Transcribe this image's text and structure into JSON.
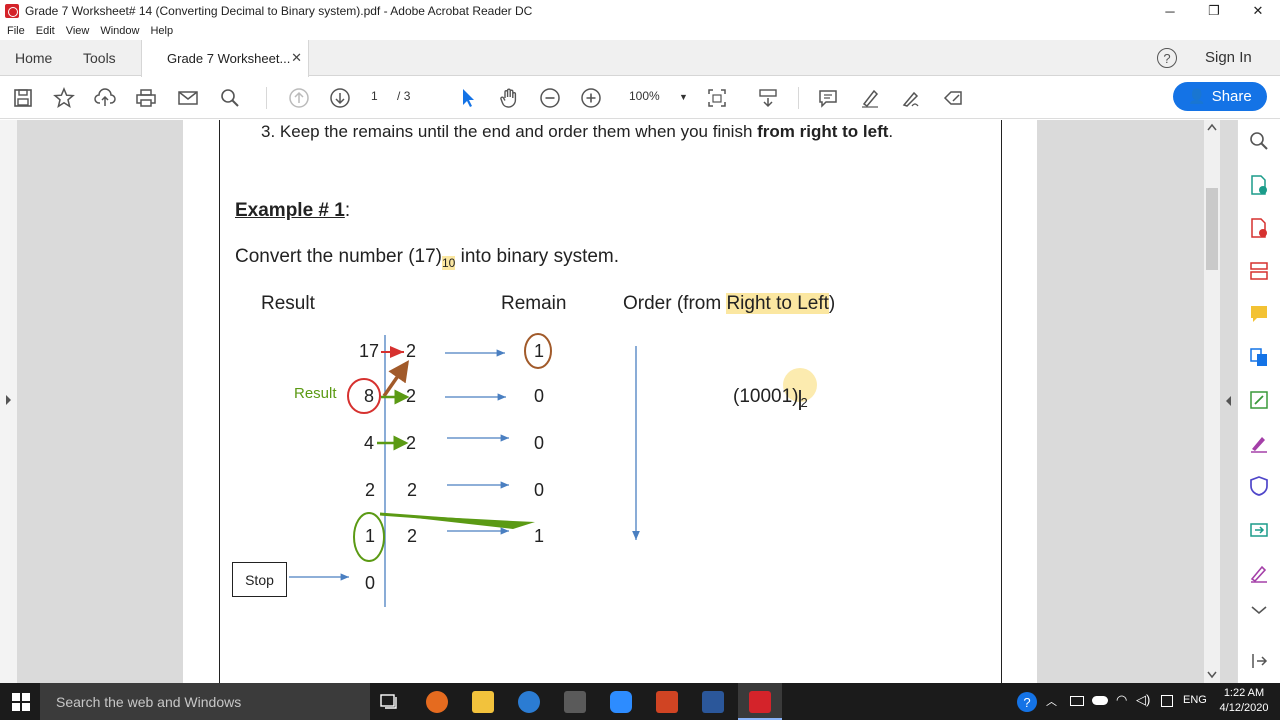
{
  "window": {
    "title": "Grade 7 Worksheet# 14 (Converting Decimal to Binary system).pdf - Adobe Acrobat Reader DC",
    "minimize": "─",
    "restore": "❐",
    "close": "✕"
  },
  "menu": [
    "File",
    "Edit",
    "View",
    "Window",
    "Help"
  ],
  "tabs": {
    "home": "Home",
    "tools": "Tools",
    "document": "Grade 7 Worksheet...",
    "close": "✕",
    "help": "?",
    "sign_in": "Sign In"
  },
  "toolbar": {
    "page_current": "1",
    "page_total": "/ 3",
    "zoom": "100%",
    "share": "Share"
  },
  "document": {
    "step3_prefix": "3.  Keep the remains until the end and order them when you finish ",
    "step3_bold": "from right to left",
    "step3_suffix": ".",
    "example_title": "Example # 1",
    "example_colon": ":",
    "convert_prefix": "Convert the number (17)",
    "convert_sub": "10",
    "convert_suffix": " into binary system.",
    "col_result": "Result",
    "col_remain": "Remain",
    "col_order_prefix": "Order (from ",
    "col_order_highlight": "Right to Left",
    "col_order_suffix": ")",
    "result_label": "Result",
    "stop_label": "Stop",
    "answer": "(10001)",
    "answer_sub": "2",
    "rows": [
      {
        "dividend": "17",
        "divisor": "2",
        "remain": "1"
      },
      {
        "dividend": "8",
        "divisor": "2",
        "remain": "0"
      },
      {
        "dividend": "4",
        "divisor": "2",
        "remain": "0"
      },
      {
        "dividend": "2",
        "divisor": "2",
        "remain": "0"
      },
      {
        "dividend": "1",
        "divisor": "2",
        "remain": "1"
      },
      {
        "dividend": "0",
        "divisor": "",
        "remain": ""
      }
    ]
  },
  "taskbar": {
    "search_placeholder": "Search the web and Windows",
    "language": "ENG",
    "time": "1:22 AM",
    "date": "4/12/2020"
  },
  "colors": {
    "accent": "#1473e6",
    "red": "#d6312f",
    "green": "#5b9a14",
    "brown": "#a15a2a",
    "blue_arrow": "#4a7fc1",
    "highlight": "#fbe7a1"
  }
}
